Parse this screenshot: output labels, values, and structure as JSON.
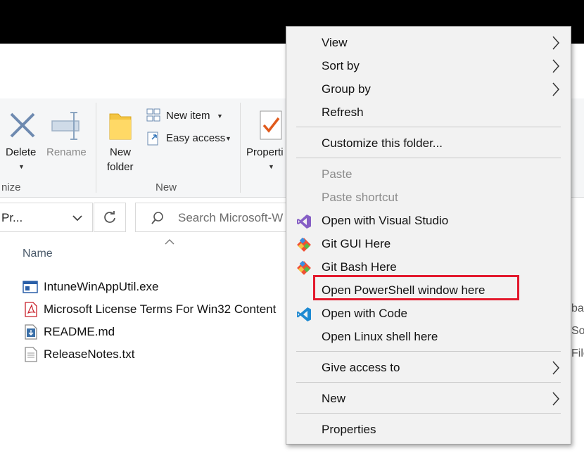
{
  "ribbon": {
    "delete_label": "Delete",
    "rename_label": "Rename",
    "new_folder_label_1": "New",
    "new_folder_label_2": "folder",
    "new_item_label": "New item",
    "easy_access_label": "Easy access",
    "properties_label": "Properti",
    "group_organize": "nize",
    "group_new": "New"
  },
  "address_bar": {
    "path": "Pr..."
  },
  "search": {
    "placeholder": "Search Microsoft-W"
  },
  "file_list": {
    "column_name": "Name",
    "files": [
      {
        "name": "IntuneWinAppUtil.exe",
        "icon": "exe-icon"
      },
      {
        "name": "Microsoft License Terms For Win32 Content",
        "icon": "pdf-icon"
      },
      {
        "name": "README.md",
        "icon": "markdown-icon"
      },
      {
        "name": "ReleaseNotes.txt",
        "icon": "text-file-icon"
      }
    ],
    "right_cut": [
      "ba",
      "Sou",
      "File"
    ]
  },
  "context_menu": {
    "items": [
      {
        "label": "View",
        "submenu": true
      },
      {
        "label": "Sort by",
        "submenu": true
      },
      {
        "label": "Group by",
        "submenu": true
      },
      {
        "label": "Refresh"
      },
      {
        "label": "Customize this folder..."
      },
      {
        "label": "Paste",
        "disabled": true
      },
      {
        "label": "Paste shortcut",
        "disabled": true
      },
      {
        "label": "Open with Visual Studio",
        "icon": "visual-studio-icon"
      },
      {
        "label": "Git GUI Here",
        "icon": "git-icon"
      },
      {
        "label": "Git Bash Here",
        "icon": "git-icon"
      },
      {
        "label": "Open PowerShell window here",
        "highlighted": true
      },
      {
        "label": "Open with Code",
        "icon": "vscode-icon"
      },
      {
        "label": "Open Linux shell here"
      },
      {
        "label": "Give access to",
        "submenu": true
      },
      {
        "label": "New",
        "submenu": true
      },
      {
        "label": "Properties"
      }
    ]
  },
  "colors": {
    "highlight_border": "#e3192d",
    "menu_bg": "#f2f2f2",
    "folder_yellow": "#f4c542",
    "vs_purple": "#865fc5",
    "vscode_blue": "#1f8ad2"
  }
}
